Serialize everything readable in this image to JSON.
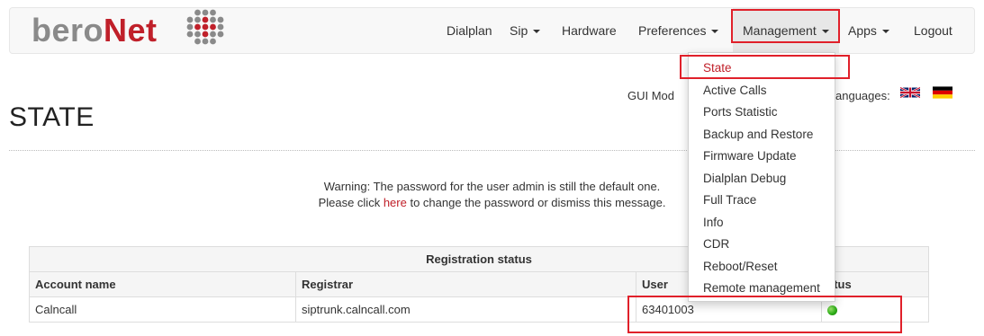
{
  "brand": {
    "part1": "bero",
    "part2": "Net"
  },
  "nav": {
    "dialplan": "Dialplan",
    "sip": "Sip",
    "hardware": "Hardware",
    "preferences": "Preferences",
    "management": "Management",
    "apps": "Apps",
    "logout": "Logout"
  },
  "management_menu": [
    "State",
    "Active Calls",
    "Ports Statistic",
    "Backup and Restore",
    "Firmware Update",
    "Dialplan Debug",
    "Full Trace",
    "Info",
    "CDR",
    "Reboot/Reset",
    "Remote management"
  ],
  "header": {
    "gui_mode": "GUI Mod",
    "languages": "anguages:"
  },
  "page": {
    "title": "STATE"
  },
  "warning": {
    "line1": "Warning: The password for the user admin is still the default one.",
    "line2_before": "Please click ",
    "line2_link": "here",
    "line2_after": " to change the password or dismiss this message."
  },
  "registration": {
    "caption": "Registration status",
    "columns": [
      "Account name",
      "Registrar",
      "User",
      "atus"
    ],
    "rows": [
      {
        "account": "Calncall",
        "registrar": "siptrunk.calncall.com",
        "user": "63401003",
        "status": "green"
      }
    ]
  },
  "colors": {
    "brand_red": "#c0202a",
    "annotation_red": "#e0202a",
    "status_green": "#2faf1a"
  }
}
